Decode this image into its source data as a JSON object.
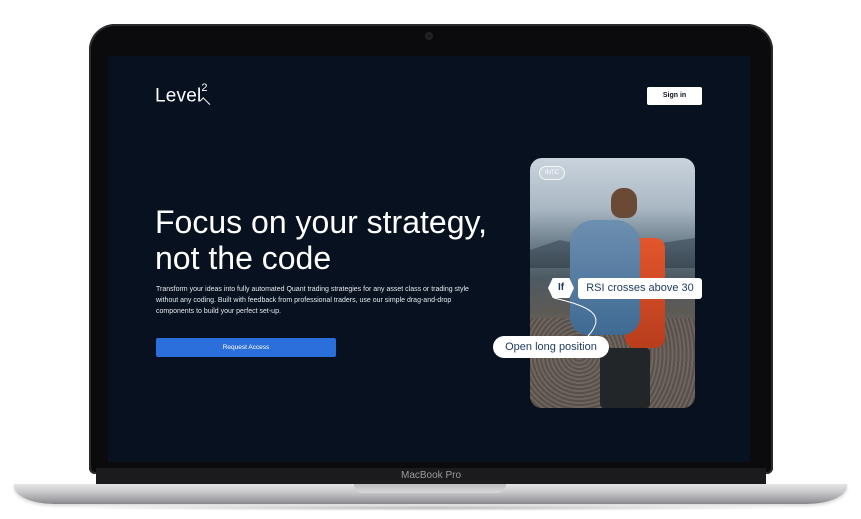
{
  "device": {
    "label": "MacBook Pro"
  },
  "header": {
    "logo_text": "Level",
    "logo_superscript": "2",
    "signin_label": "Sign in"
  },
  "hero": {
    "headline": "Focus on your strategy, not the code",
    "subtext": "Transform your ideas into fully automated Quant trading strategies for any asset class or trading style without any coding. Built with feedback from professional traders, use our simple drag-and-drop components to build your perfect set-up.",
    "cta_label": "Request Access"
  },
  "visual": {
    "ticker": "INTC",
    "if_label": "If",
    "condition": "RSI crosses above 30",
    "action": "Open long position"
  },
  "colors": {
    "background": "#07111f",
    "accent": "#2a6fdb",
    "chip_text": "#1d3a5f"
  }
}
